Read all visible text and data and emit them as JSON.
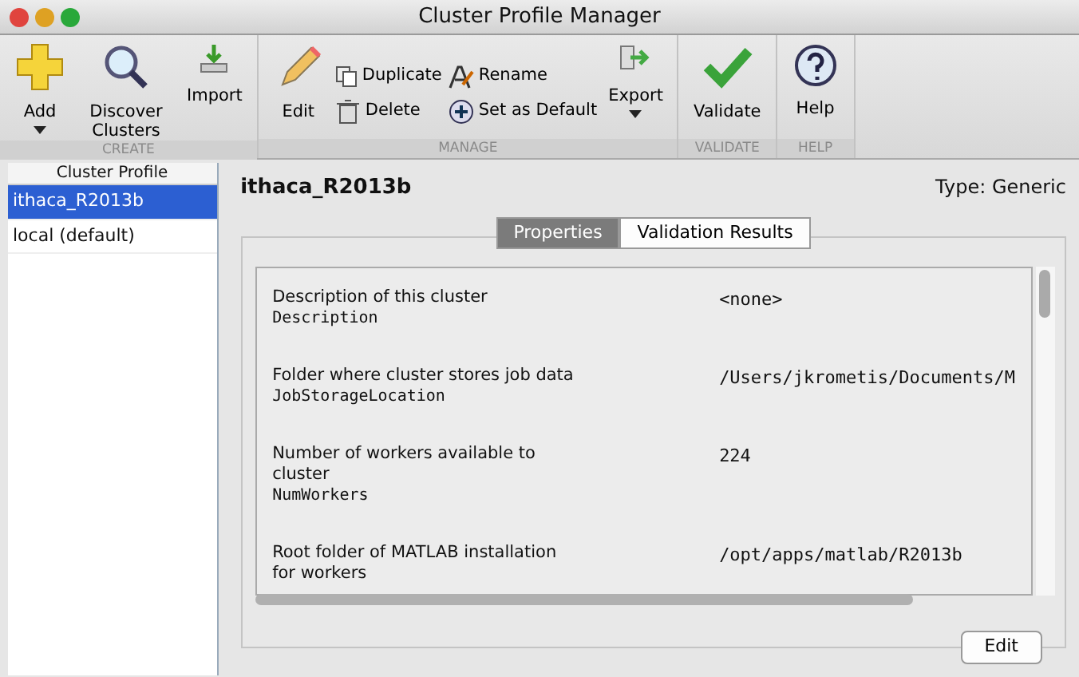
{
  "window": {
    "title": "Cluster Profile Manager"
  },
  "toolbar": {
    "groups": [
      {
        "label": "CREATE",
        "items": [
          {
            "kind": "large",
            "label": "Add",
            "dropdown": true
          },
          {
            "kind": "large",
            "label": "Discover Clusters",
            "dropdown": false
          },
          {
            "kind": "large",
            "label": "Import",
            "dropdown": false
          }
        ]
      },
      {
        "label": "MANAGE",
        "items": [
          {
            "kind": "large",
            "label": "Edit",
            "dropdown": false
          },
          {
            "kind": "stack",
            "buttons": [
              {
                "label": "Duplicate"
              },
              {
                "label": "Delete"
              }
            ]
          },
          {
            "kind": "stack",
            "buttons": [
              {
                "label": "Rename"
              },
              {
                "label": "Set as Default"
              }
            ]
          },
          {
            "kind": "large",
            "label": "Export",
            "dropdown": true
          }
        ]
      },
      {
        "label": "VALIDATE",
        "items": [
          {
            "kind": "large",
            "label": "Validate",
            "dropdown": false
          }
        ]
      },
      {
        "label": "HELP",
        "items": [
          {
            "kind": "large",
            "label": "Help",
            "dropdown": false
          }
        ]
      }
    ]
  },
  "profile_list": {
    "header": "Cluster Profile",
    "items": [
      {
        "label": "ithaca_R2013b",
        "selected": true
      },
      {
        "label": "local (default)",
        "selected": false
      }
    ]
  },
  "profile": {
    "name": "ithaca_R2013b",
    "type": "Type: Generic",
    "tabs": [
      {
        "label": "Properties",
        "selected": true
      },
      {
        "label": "Validation Results",
        "selected": false
      }
    ],
    "properties": [
      {
        "description": "Description of this cluster",
        "property": "Description",
        "value": "<none>"
      },
      {
        "description": "Folder where cluster stores job data",
        "property": "JobStorageLocation",
        "value": "/Users/jkrometis/Documents/M"
      },
      {
        "description": "Number of workers available to cluster",
        "property": "NumWorkers",
        "value": "224"
      },
      {
        "description": "Root folder of MATLAB installation for workers",
        "value": "/opt/apps/matlab/R2013b"
      }
    ],
    "edit_button": "Edit"
  }
}
